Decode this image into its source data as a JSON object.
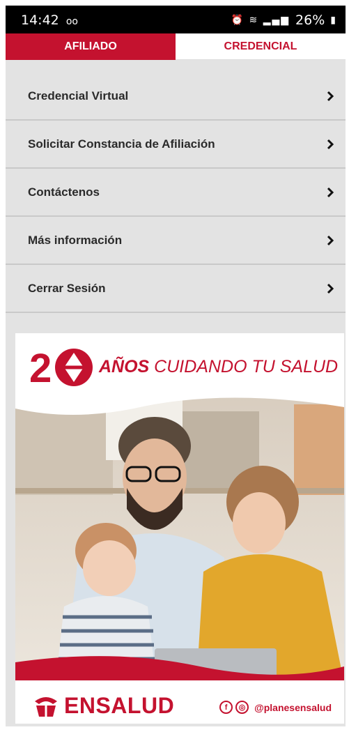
{
  "status_bar": {
    "time": "14:42",
    "voicemail_icon": "voicemail-icon",
    "battery": "26%",
    "icons": [
      "alarm-icon",
      "wifi-icon",
      "signal-icon",
      "battery-icon"
    ]
  },
  "tabs": [
    {
      "label": "AFILIADO",
      "active": true
    },
    {
      "label": "CREDENCIAL",
      "active": false
    }
  ],
  "menu": {
    "items": [
      {
        "label": "Credencial Virtual"
      },
      {
        "label": "Solicitar Constancia de Afiliación"
      },
      {
        "label": "Contáctenos"
      },
      {
        "label": "Más información"
      },
      {
        "label": "Cerrar Sesión"
      }
    ]
  },
  "banner": {
    "years_logo": "20",
    "tagline_bold": "AÑOS",
    "tagline_rest": " CUIDANDO TU SALUD",
    "brand": "ENSALUD",
    "social_handle": "@planesensalud",
    "social_icons": [
      "facebook-icon",
      "instagram-icon"
    ]
  },
  "colors": {
    "brand_red": "#c4122f",
    "menu_bg": "#e3e3e3",
    "text_dark": "#2a2a2a"
  }
}
